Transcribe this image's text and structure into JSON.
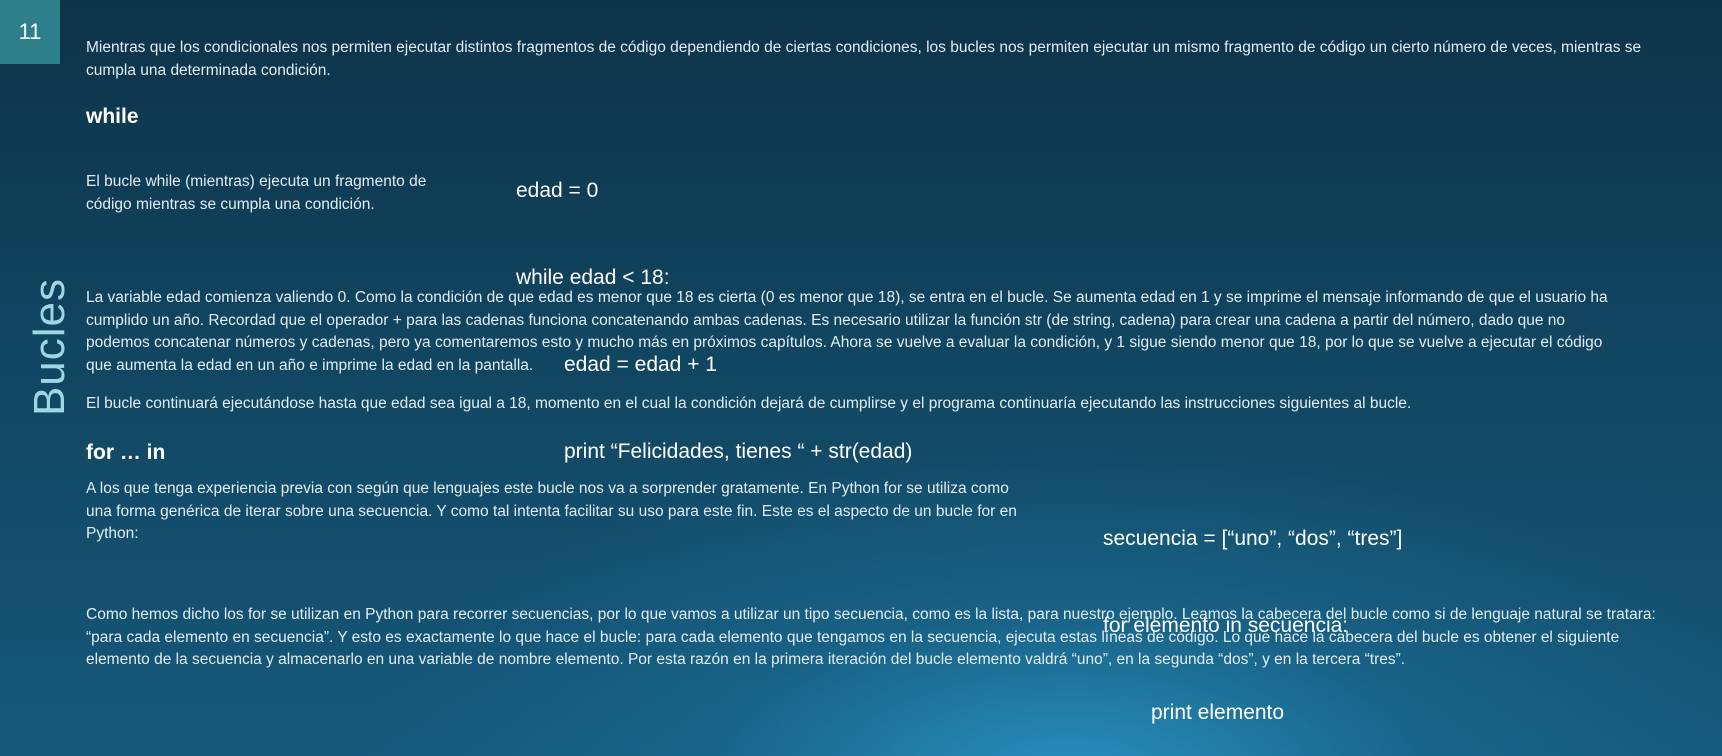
{
  "slide": {
    "number": "11",
    "section_title": "Bucles"
  },
  "intro": "Mientras que los condicionales nos permiten ejecutar distintos fragmentos de código dependiendo de ciertas condiciones, los bucles nos permiten ejecutar un mismo fragmento de código un cierto número de veces, mientras se cumpla una determinada condición.",
  "while_section": {
    "heading": "while",
    "description": "El bucle while (mientras) ejecuta un fragmento de código mientras se cumpla una condición.",
    "code": [
      "edad = 0",
      "while edad < 18:",
      "edad = edad + 1",
      "print “Felicidades, tienes “ + str(edad)"
    ],
    "explanation_1": "La variable edad comienza valiendo 0. Como la condición de que edad es menor que 18 es cierta (0 es menor que 18), se entra en el bucle. Se aumenta edad en 1 y se imprime el mensaje informando de que el usuario ha cumplido un año. Recordad que el operador + para las cadenas funciona concatenando ambas cadenas. Es necesario utilizar la función str (de string, cadena) para crear una cadena a partir del número, dado que no podemos concatenar números y cadenas, pero ya comentaremos esto y mucho más en próximos capítulos. Ahora se vuelve a evaluar la condición, y 1 sigue siendo menor que 18, por lo que se vuelve a ejecutar el código que aumenta la edad en un año e imprime la edad en la pantalla.",
    "explanation_2": "El bucle continuará ejecutándose hasta que edad sea igual a 18, momento en el cual la condición dejará de cumplirse y el programa continuaría ejecutando las instrucciones siguientes al bucle."
  },
  "for_section": {
    "heading": "for … in",
    "description": "A los que tenga experiencia previa con según que lenguajes este bucle nos va a sorprender gratamente. En Python for se utiliza como una forma genérica de iterar sobre una secuencia. Y como tal intenta facilitar su uso para este fin. Este es el aspecto de un bucle for en Python:",
    "code": [
      "secuencia = [“uno”, “dos”, “tres”]",
      "for elemento in secuencia:",
      "print elemento"
    ],
    "explanation": "Como hemos dicho los for se utilizan en Python para recorrer secuencias, por lo que vamos a utilizar un tipo secuencia, como es la lista, para nuestro ejemplo. Leamos la cabecera del bucle como si de lenguaje natural se tratara: “para cada elemento en secuencia”. Y esto es exactamente lo que hace el bucle: para cada elemento que tengamos en la secuencia, ejecuta estas líneas de código. Lo que hace la cabecera del bucle es obtener el siguiente elemento de la secuencia y almacenarlo en una variable de nombre elemento. Por esta razón en la primera iteración del bucle elemento valdrá “uno”, en la segunda “dos”, y en la tercera “tres”."
  }
}
